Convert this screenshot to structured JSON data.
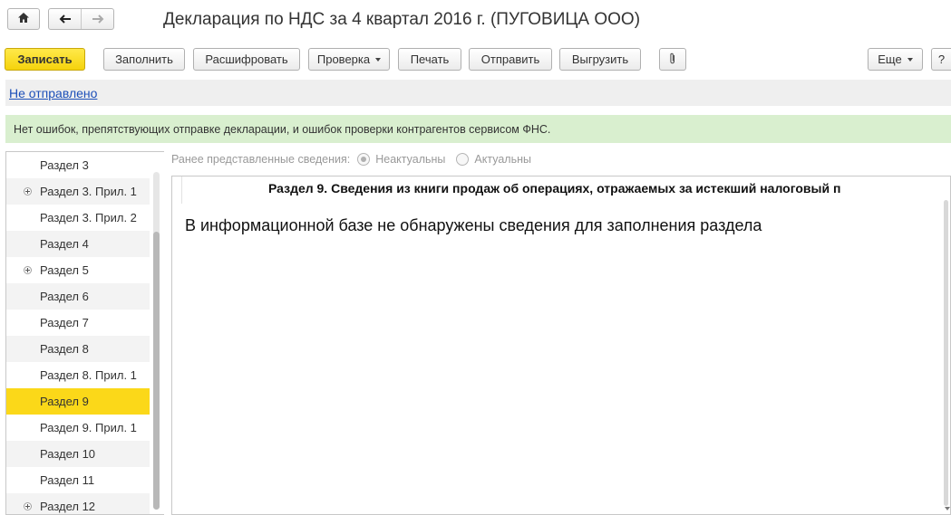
{
  "window": {
    "title": "Декларация по НДС за 4 квартал 2016 г. (ПУГОВИЦА ООО)"
  },
  "toolbar": {
    "save_label": "Записать",
    "fill_label": "Заполнить",
    "decode_label": "Расшифровать",
    "check_label": "Проверка",
    "print_label": "Печать",
    "send_label": "Отправить",
    "export_label": "Выгрузить",
    "more_label": "Еще",
    "help_label": "?"
  },
  "status": {
    "link_text": "Не отправлено"
  },
  "info": {
    "message": "Нет ошибок, препятствующих отправке декларации, и ошибок проверки контрагентов сервисом ФНС."
  },
  "sections": {
    "items": [
      {
        "label": "Раздел 3",
        "expandable": false,
        "selected": false
      },
      {
        "label": "Раздел 3. Прил. 1",
        "expandable": true,
        "selected": false
      },
      {
        "label": "Раздел 3. Прил. 2",
        "expandable": false,
        "selected": false
      },
      {
        "label": "Раздел 4",
        "expandable": false,
        "selected": false
      },
      {
        "label": "Раздел 5",
        "expandable": true,
        "selected": false
      },
      {
        "label": "Раздел 6",
        "expandable": false,
        "selected": false
      },
      {
        "label": "Раздел 7",
        "expandable": false,
        "selected": false
      },
      {
        "label": "Раздел 8",
        "expandable": false,
        "selected": false
      },
      {
        "label": "Раздел 8. Прил. 1",
        "expandable": false,
        "selected": false
      },
      {
        "label": "Раздел 9",
        "expandable": false,
        "selected": true
      },
      {
        "label": "Раздел 9. Прил. 1",
        "expandable": false,
        "selected": false
      },
      {
        "label": "Раздел 10",
        "expandable": false,
        "selected": false
      },
      {
        "label": "Раздел 11",
        "expandable": false,
        "selected": false
      },
      {
        "label": "Раздел 12",
        "expandable": true,
        "selected": false
      }
    ]
  },
  "previous_info": {
    "label": "Ранее представленные сведения:",
    "option_outdated": "Неактуальны",
    "option_current": "Актуальны",
    "selected": "Неактуальны"
  },
  "document": {
    "section_title": "Раздел 9. Сведения из книги продаж об операциях, отражаемых за истекший налоговый п",
    "message": "В информационной базе не обнаружены сведения для заполнения раздела"
  },
  "colors": {
    "accent_yellow": "#fbd819",
    "info_green": "#d9efcf",
    "link_blue": "#1c4fb8"
  }
}
